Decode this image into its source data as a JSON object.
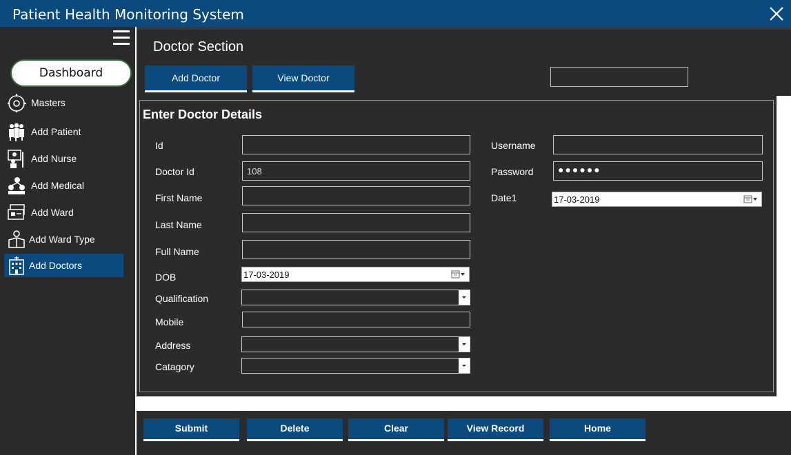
{
  "window": {
    "title": "Patient Health Monitoring System"
  },
  "sidebar": {
    "dashboard_label": "Dashboard",
    "items": [
      {
        "label": "Masters",
        "icon": "gear-icon"
      },
      {
        "label": "Add  Patient",
        "icon": "patients-icon"
      },
      {
        "label": "Add Nurse",
        "icon": "nurse-icon"
      },
      {
        "label": "Add Medical",
        "icon": "medical-icon"
      },
      {
        "label": "Add Ward",
        "icon": "ward-icon"
      },
      {
        "label": "Add Ward Type",
        "icon": "ward-type-icon"
      },
      {
        "label": "Add Doctors",
        "icon": "hospital-icon",
        "active": true
      }
    ]
  },
  "header": {
    "section_title": "Doctor Section",
    "tabs": [
      "Add Doctor",
      "View Doctor"
    ],
    "search_value": ""
  },
  "form": {
    "title": "Enter Doctor Details",
    "left_fields": {
      "id": {
        "label": "Id",
        "value": ""
      },
      "doctor_id": {
        "label": "Doctor Id",
        "value": "108"
      },
      "first_name": {
        "label": "First Name",
        "value": ""
      },
      "last_name": {
        "label": "Last Name",
        "value": ""
      },
      "full_name": {
        "label": "Full Name",
        "value": ""
      },
      "dob": {
        "label": "DOB",
        "value": "17-03-2019"
      },
      "qualification": {
        "label": "Qualification",
        "value": ""
      },
      "mobile": {
        "label": "Mobile",
        "value": ""
      },
      "address": {
        "label": "Address",
        "value": ""
      },
      "catagory": {
        "label": "Catagory",
        "value": ""
      }
    },
    "right_fields": {
      "username": {
        "label": "Username",
        "value": ""
      },
      "password": {
        "label": "Password",
        "value": "●●●●●●"
      },
      "date1": {
        "label": "Date1",
        "value": "17-03-2019"
      }
    }
  },
  "actions": [
    "Submit",
    "Delete",
    "Clear",
    "View Record",
    "Home"
  ],
  "colors": {
    "accent": "#0b4a7e",
    "panel": "#2b2b2b",
    "sidebar": "#2a2a2a"
  }
}
